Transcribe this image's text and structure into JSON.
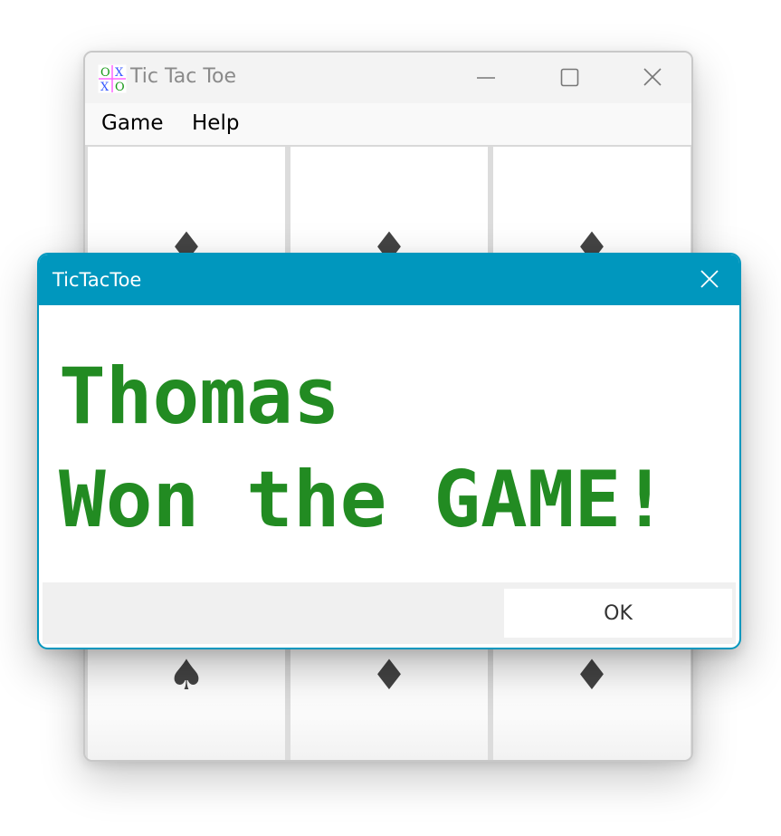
{
  "main_window": {
    "title": "Tic Tac Toe",
    "app_icon": "tic-tac-toe-icon",
    "app_icon_glyphs": [
      "O",
      "X",
      "X",
      "O"
    ],
    "caption_buttons": [
      "minimize-icon",
      "maximize-icon",
      "close-icon"
    ],
    "menu": [
      "Game",
      "Help"
    ],
    "board": {
      "visible_cells": [
        {
          "row": 0,
          "col": 0,
          "suit": "diamond"
        },
        {
          "row": 0,
          "col": 1,
          "suit": "diamond"
        },
        {
          "row": 0,
          "col": 2,
          "suit": "diamond"
        },
        {
          "row": 2,
          "col": 0,
          "suit": "spade"
        },
        {
          "row": 2,
          "col": 1,
          "suit": "diamond"
        },
        {
          "row": 2,
          "col": 2,
          "suit": "diamond"
        }
      ],
      "suit_color": "#444444"
    }
  },
  "dialog": {
    "title": "TicTacToe",
    "message_lines": [
      "Thomas",
      "Won the GAME!"
    ],
    "message_color": "#228b22",
    "ok_label": "OK",
    "accent_color": "#0097be"
  }
}
